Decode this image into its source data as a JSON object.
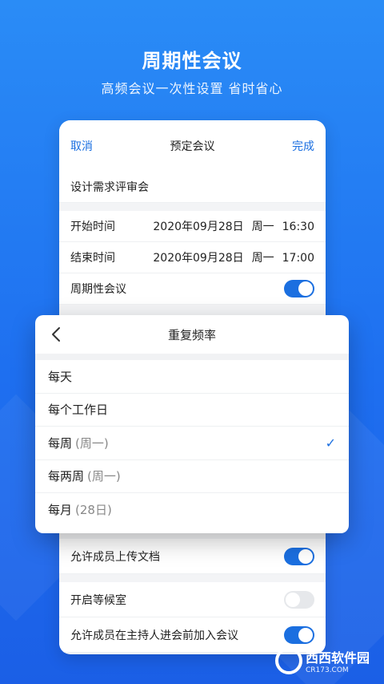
{
  "hero": {
    "title": "周期性会议",
    "subtitle": "高频会议一次性设置 省时省心"
  },
  "nav": {
    "cancel": "取消",
    "title": "预定会议",
    "done": "完成"
  },
  "form": {
    "meeting_name": "设计需求评审会",
    "start_label": "开始时间",
    "start_date": "2020年09月28日",
    "start_weekday": "周一",
    "start_time": "16:30",
    "end_label": "结束时间",
    "end_date": "2020年09月28日",
    "end_weekday": "周一",
    "end_time": "17:00",
    "recurring_label": "周期性会议",
    "recurring_on": true
  },
  "sheet": {
    "title": "重复频率",
    "options": [
      {
        "label": "每天",
        "hint": ""
      },
      {
        "label": "每个工作日",
        "hint": ""
      },
      {
        "label": "每周",
        "hint": "(周一)",
        "selected": true
      },
      {
        "label": "每两周",
        "hint": "(周一)"
      },
      {
        "label": "每月",
        "hint": "(28日)"
      }
    ]
  },
  "settings": {
    "upload_docs_label": "允许成员上传文档",
    "upload_docs_on": true,
    "waiting_room_label": "开启等候室",
    "waiting_room_on": false,
    "join_before_host_label": "允许成员在主持人进会前加入会议",
    "join_before_host_on": true
  },
  "watermark": {
    "brand": "西西软件园",
    "site": "CR173.COM"
  },
  "colors": {
    "accent": "#1b6fe0",
    "background_top": "#2a8cf6",
    "background_bottom": "#1b5fe6"
  }
}
